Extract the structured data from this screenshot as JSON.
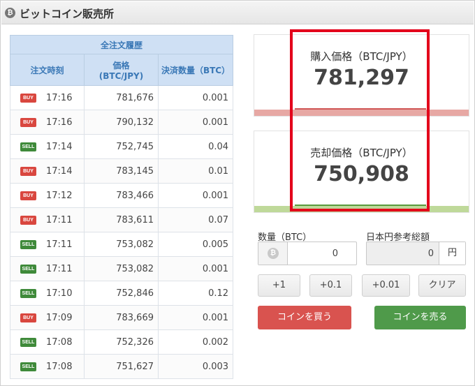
{
  "header": {
    "title": "ビットコイン販売所",
    "coin_symbol": "₿"
  },
  "history": {
    "caption": "全注文履歴",
    "columns": [
      "注文時刻",
      "価格\n(BTC/JPY)",
      "決済数量（BTC）"
    ],
    "rows": [
      {
        "side": "BUY",
        "time": "17:16",
        "price": "781,676",
        "amount": "0.001"
      },
      {
        "side": "BUY",
        "time": "17:16",
        "price": "790,132",
        "amount": "0.001"
      },
      {
        "side": "SELL",
        "time": "17:14",
        "price": "752,745",
        "amount": "0.04"
      },
      {
        "side": "BUY",
        "time": "17:14",
        "price": "783,145",
        "amount": "0.01"
      },
      {
        "side": "BUY",
        "time": "17:12",
        "price": "783,466",
        "amount": "0.001"
      },
      {
        "side": "BUY",
        "time": "17:11",
        "price": "783,611",
        "amount": "0.07"
      },
      {
        "side": "SELL",
        "time": "17:11",
        "price": "753,082",
        "amount": "0.005"
      },
      {
        "side": "SELL",
        "time": "17:11",
        "price": "753,082",
        "amount": "0.001"
      },
      {
        "side": "SELL",
        "time": "17:10",
        "price": "752,846",
        "amount": "0.12"
      },
      {
        "side": "BUY",
        "time": "17:09",
        "price": "783,669",
        "amount": "0.001"
      },
      {
        "side": "SELL",
        "time": "17:08",
        "price": "752,326",
        "amount": "0.002"
      },
      {
        "side": "SELL",
        "time": "17:08",
        "price": "751,627",
        "amount": "0.003"
      }
    ]
  },
  "prices": {
    "buy_label": "購入価格（BTC/JPY）",
    "buy_value": "781,297",
    "sell_label": "売却価格（BTC/JPY）",
    "sell_value": "750,908"
  },
  "form": {
    "qty_label": "数量（BTC）",
    "qty_value": "0",
    "jpy_label": "日本円参考総額",
    "jpy_value": "0",
    "jpy_unit": "円",
    "step_buttons": [
      "+1",
      "+0.1",
      "+0.01",
      "クリア"
    ],
    "buy_button": "コインを買う",
    "sell_button": "コインを売る"
  },
  "colors": {
    "buy": "#d9534f",
    "sell": "#4f9a4a",
    "highlight": "#e3001b",
    "table_header": "#cfe0f4"
  }
}
